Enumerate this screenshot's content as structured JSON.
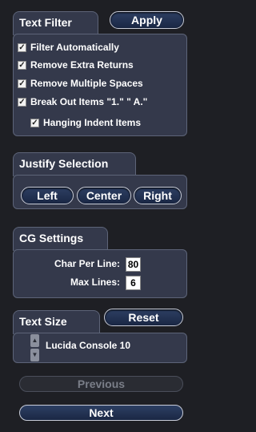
{
  "text_filter": {
    "title": "Text Filter",
    "apply_label": "Apply",
    "options": [
      {
        "label": "Filter Automatically",
        "checked": true
      },
      {
        "label": "Remove Extra Returns",
        "checked": true
      },
      {
        "label": "Remove Multiple Spaces",
        "checked": true
      },
      {
        "label": "Break Out Items \"1.\" \" A.\"",
        "checked": true
      }
    ],
    "sub_option": {
      "label": "Hanging Indent Items",
      "checked": true
    }
  },
  "justify": {
    "title": "Justify Selection",
    "left_label": "Left",
    "center_label": "Center",
    "right_label": "Right"
  },
  "cg": {
    "title": "CG Settings",
    "char_per_line_label": "Char Per Line:",
    "char_per_line_value": "80",
    "max_lines_label": "Max Lines:",
    "max_lines_value": "6"
  },
  "text_size": {
    "title": "Text Size",
    "reset_label": "Reset",
    "font_value": "Lucida Console 10"
  },
  "nav": {
    "previous_label": "Previous",
    "next_label": "Next"
  },
  "icons": {
    "check": "check-icon",
    "up": "arrow-up-icon",
    "down": "arrow-down-icon"
  }
}
